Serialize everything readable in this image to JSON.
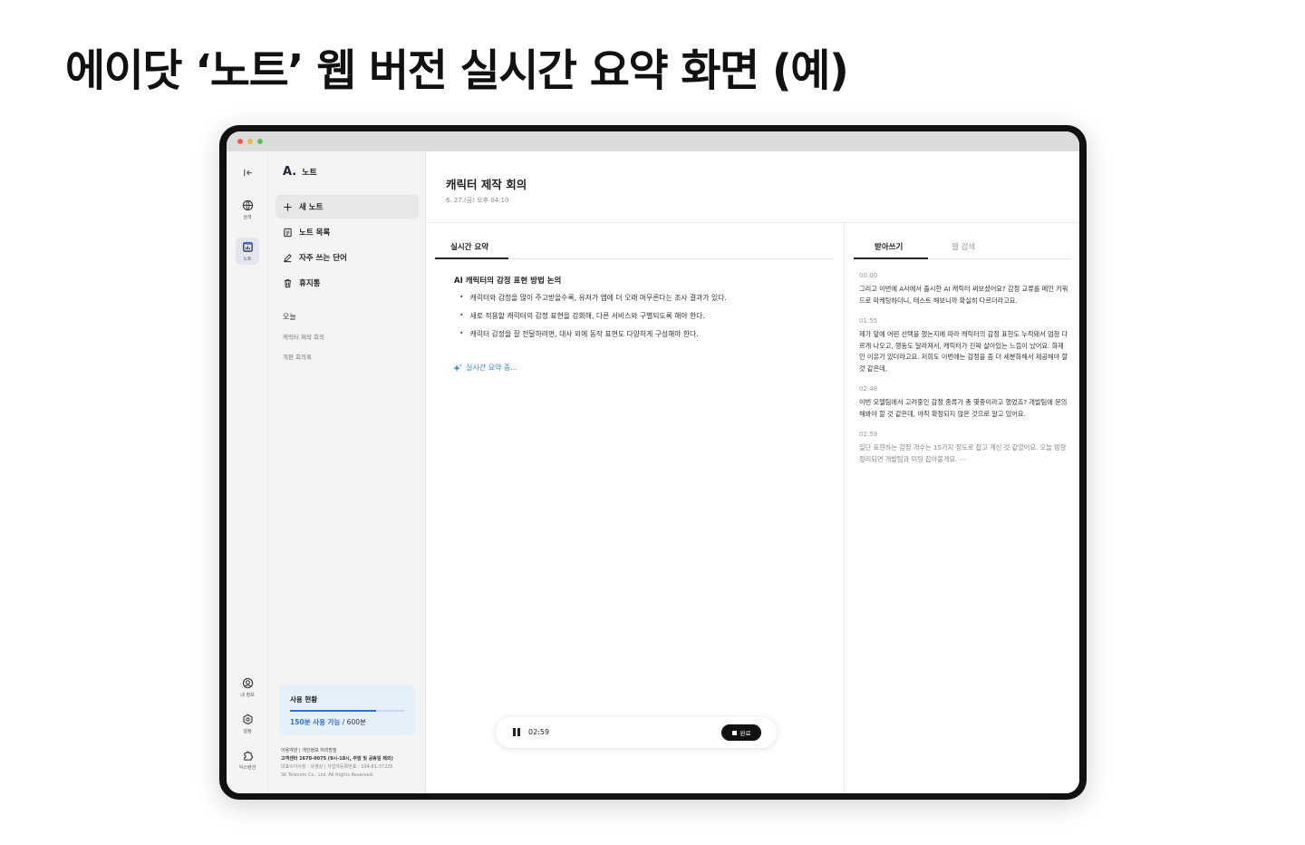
{
  "heading": "에이닷 ‘노트’ 웹 버전 실시간 요약 화면 (예)",
  "rail": {
    "items": [
      {
        "label": "검색",
        "icon": "globe-icon"
      },
      {
        "label": "노트",
        "icon": "note-icon"
      },
      {
        "label": "내 정보",
        "icon": "profile-icon"
      },
      {
        "label": "설정",
        "icon": "settings-icon"
      },
      {
        "label": "익스텐션",
        "icon": "extension-icon"
      }
    ]
  },
  "nav": {
    "brand_logo": "A.",
    "brand_name": "노트",
    "items": [
      {
        "label": "새 노트",
        "icon": "plus-icon"
      },
      {
        "label": "노트 목록",
        "icon": "list-icon"
      },
      {
        "label": "자주 쓰는 단어",
        "icon": "pencil-icon"
      },
      {
        "label": "휴지통",
        "icon": "trash-icon"
      }
    ],
    "section": "오늘",
    "notes": [
      "캐릭터 제작 회의",
      "개편 회의록"
    ],
    "usage": {
      "title": "사용 현황",
      "available": "150분 사용 가능",
      "total": " / 600분",
      "fraction": 0.75
    },
    "footer": {
      "line1": "이용약관 | 개인정보 처리방침",
      "line2": "고객센터 1670-0075 (9시-18시, 주말 및 공휴일 제외)",
      "line3": "대표이사사장 : 유영상 | 사업자등록번호 : 104-81-37225",
      "line4": "SK Telecom Co., Ltd.  All Rights Reserved."
    }
  },
  "note": {
    "title": "캐릭터 제작 회의",
    "date": "6. 27.(금) 오후 04:10"
  },
  "summary": {
    "tab": "실시간 요약",
    "heading": "AI 캐릭터의 감정 표현 방법 논의",
    "bullets": [
      "캐릭터와 감정을 많이 주고받을수록, 유저가 앱에 더 오래 머무른다는 조사 결과가 있다.",
      "새로 적용할 캐릭터의 감정 표현을 강화해, 다른 서비스와 구별되도록 해야 한다.",
      "캐릭터 감정을 잘 전달하려면, 대사 외에 동작 표현도 다양하게 구성해야 한다."
    ],
    "status": "실시간 요약 중..."
  },
  "transcript": {
    "tabs": [
      "받아쓰기",
      "웹 검색"
    ],
    "segments": [
      {
        "time": "00:00",
        "text": "그리고 이번에 A사에서 출시한 AI 캐릭터 써보셨어요? 감정 교류를 메인 키워드로 마케팅하더니, 테스트 해보니까 확실히 다르더라고요."
      },
      {
        "time": "01:55",
        "text": "제가 앞에 어떤 선택을 했는지에 따라 캐릭터의 감정 표현도 누적돼서 엄청 다르게 나오고, 행동도 달라져서, 캐릭터가 진짜 살아있는 느낌이 났어요. 화제인 이유가 있더라고요. 저희도 이번에는 감정을 좀 더 세분화해서 제공해야 할 것 같은데,"
      },
      {
        "time": "02:48",
        "text": "이번 모델팀에서 고려중인 감정 종류가 총 몇종이라고 했었죠? 개발팀에 문의해봐야 할 것 같은데, 아직 확정되지 않은 것으로 알고 있어요."
      },
      {
        "time": "02:59",
        "text": "일단 표현하는 감정 개수는 15가지 정도로 잡고 계신 것 같았어요. 오늘 방향 정리되면 개발팀과 미팅 잡아볼게요. ⋯"
      }
    ]
  },
  "recorder": {
    "time": "02:59",
    "done_label": "완료"
  }
}
